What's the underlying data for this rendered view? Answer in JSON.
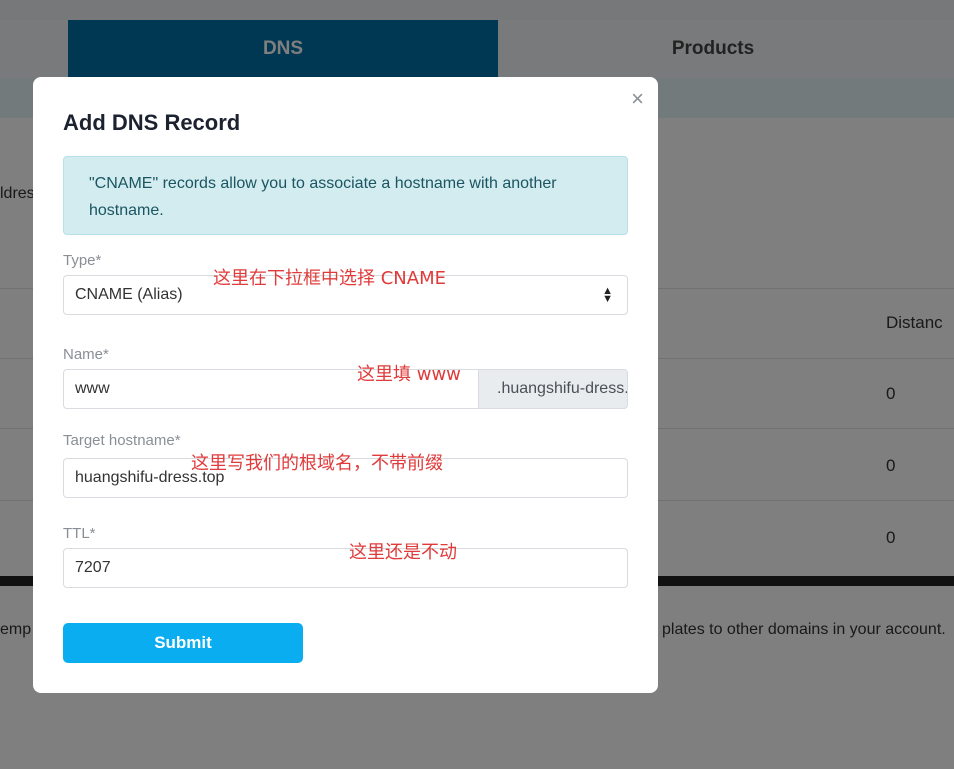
{
  "tabs": [
    {
      "label": "DNS"
    },
    {
      "label": "Products"
    }
  ],
  "background": {
    "left_fragment": "ldres",
    "column_header": "Distanc",
    "rows": [
      "0",
      "0",
      "0"
    ],
    "footer_left": "emp",
    "footer_right": "plates to other domains in your account."
  },
  "modal": {
    "title": "Add DNS Record",
    "close": "×",
    "alert": "\"CNAME\" records allow you to associate a hostname with another hostname.",
    "type_label": "Type*",
    "type_value": "CNAME (Alias)",
    "name_label": "Name*",
    "name_value": "www",
    "name_suffix": ".huangshifu-dress.top",
    "target_label": "Target hostname*",
    "target_value": "huangshifu-dress.top",
    "ttl_label": "TTL*",
    "ttl_value": "7207",
    "submit": "Submit"
  },
  "annotations": {
    "type_note": "这里在下拉框中选择 CNAME",
    "name_note": "这里填 www",
    "target_note": "这里写我们的根域名，不带前缀",
    "ttl_note": "这里还是不动"
  }
}
